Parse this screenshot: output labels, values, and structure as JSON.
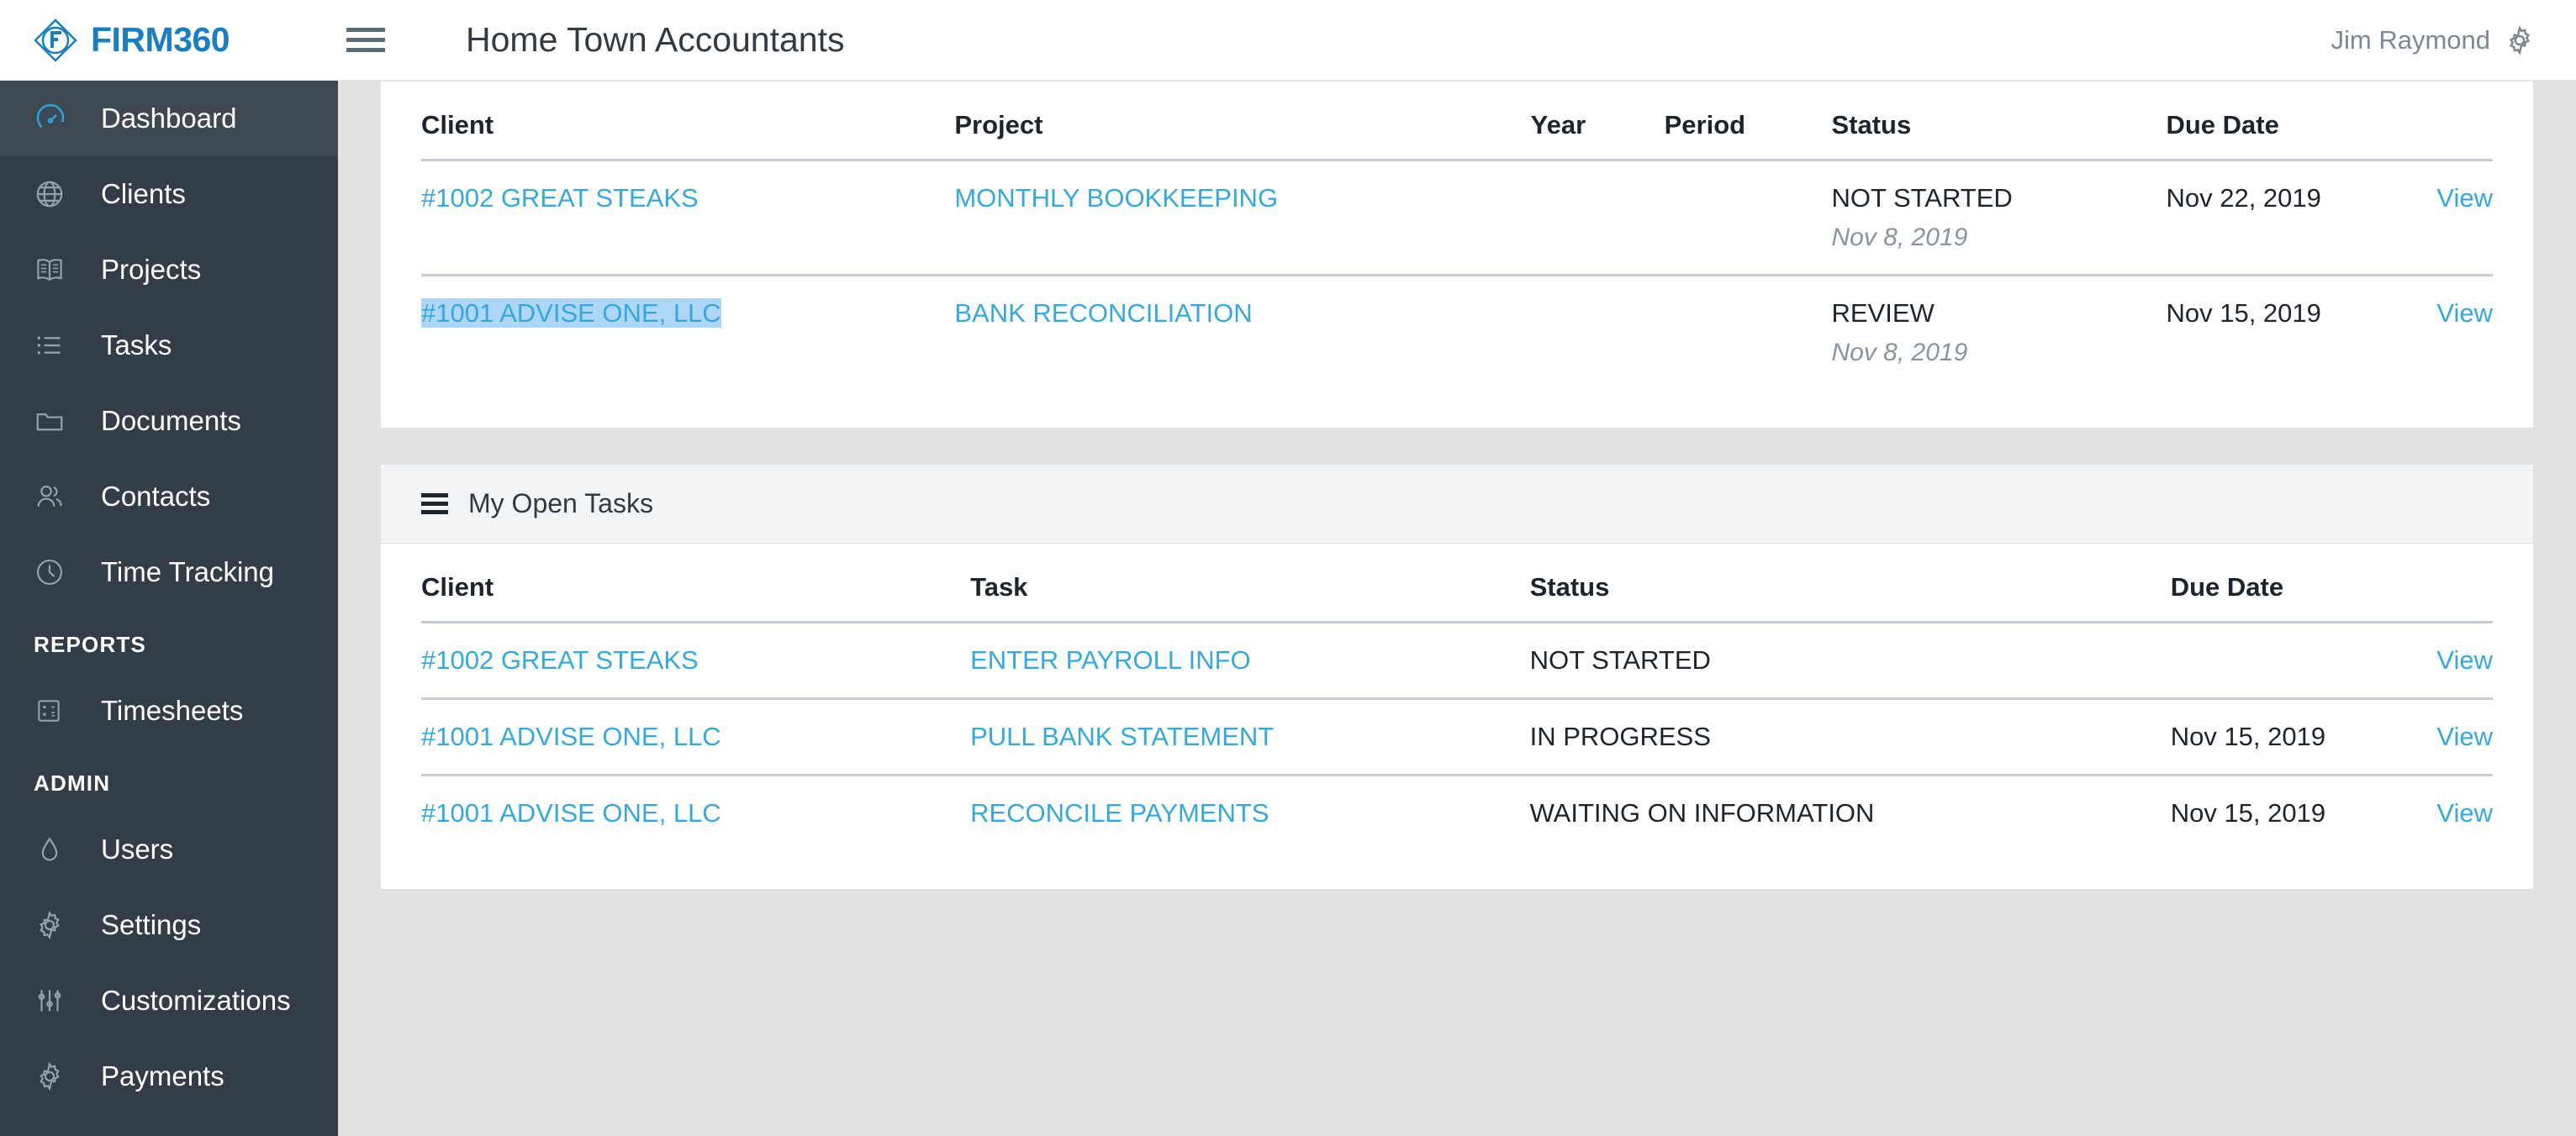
{
  "topbar": {
    "brand": "FIRM360",
    "brand_color": "#1a7fc1",
    "menu_icon": "hamburger-icon",
    "page_title": "Home Town Accountants",
    "user_name": "Jim Raymond",
    "settings_icon": "gear-icon"
  },
  "sidebar": {
    "items": [
      {
        "label": "Dashboard",
        "icon": "speedometer-icon",
        "active": true
      },
      {
        "label": "Clients",
        "icon": "globe-icon",
        "active": false
      },
      {
        "label": "Projects",
        "icon": "book-icon",
        "active": false
      },
      {
        "label": "Tasks",
        "icon": "list-icon",
        "active": false
      },
      {
        "label": "Documents",
        "icon": "folder-icon",
        "active": false
      },
      {
        "label": "Contacts",
        "icon": "contacts-icon",
        "active": false
      },
      {
        "label": "Time Tracking",
        "icon": "clock-icon",
        "active": false
      }
    ],
    "sections": [
      {
        "title": "REPORTS",
        "items": [
          {
            "label": "Timesheets",
            "icon": "calculator-icon"
          }
        ]
      },
      {
        "title": "ADMIN",
        "items": [
          {
            "label": "Users",
            "icon": "drop-icon"
          },
          {
            "label": "Settings",
            "icon": "gear-icon"
          },
          {
            "label": "Customizations",
            "icon": "sliders-icon"
          },
          {
            "label": "Payments",
            "icon": "gear-icon"
          }
        ]
      }
    ]
  },
  "projects_panel": {
    "columns": [
      "Client",
      "Project",
      "Year",
      "Period",
      "Status",
      "Due Date",
      ""
    ],
    "rows": [
      {
        "client": "#1002 GREAT STEAKS",
        "client_selected": false,
        "project": "MONTHLY BOOKKEEPING",
        "year": "",
        "period": "",
        "status": "NOT STARTED",
        "status_date": "Nov 8, 2019",
        "due_date": "Nov 22, 2019",
        "view": "View"
      },
      {
        "client": "#1001 ADVISE ONE, LLC",
        "client_selected": true,
        "project": "BANK RECONCILIATION",
        "year": "",
        "period": "",
        "status": "REVIEW",
        "status_date": "Nov 8, 2019",
        "due_date": "Nov 15, 2019",
        "view": "View"
      }
    ]
  },
  "tasks_panel": {
    "header_icon": "list-icon",
    "title": "My Open Tasks",
    "columns": [
      "Client",
      "Task",
      "Status",
      "Due Date",
      ""
    ],
    "rows": [
      {
        "client": "#1002 GREAT STEAKS",
        "task": "ENTER PAYROLL INFO",
        "status": "NOT STARTED",
        "due_date": "",
        "view": "View"
      },
      {
        "client": "#1001 ADVISE ONE, LLC",
        "task": "PULL BANK STATEMENT",
        "status": "IN PROGRESS",
        "due_date": "Nov 15, 2019",
        "view": "View"
      },
      {
        "client": "#1001 ADVISE ONE, LLC",
        "task": "RECONCILE PAYMENTS",
        "status": "WAITING ON INFORMATION",
        "due_date": "Nov 15, 2019",
        "view": "View"
      }
    ]
  },
  "colors": {
    "link": "#35a8e0",
    "sidebar_bg": "#333d47",
    "sidebar_active": "#3e4852",
    "selection": "#aed6f7",
    "page_bg": "#e2e2e2"
  }
}
